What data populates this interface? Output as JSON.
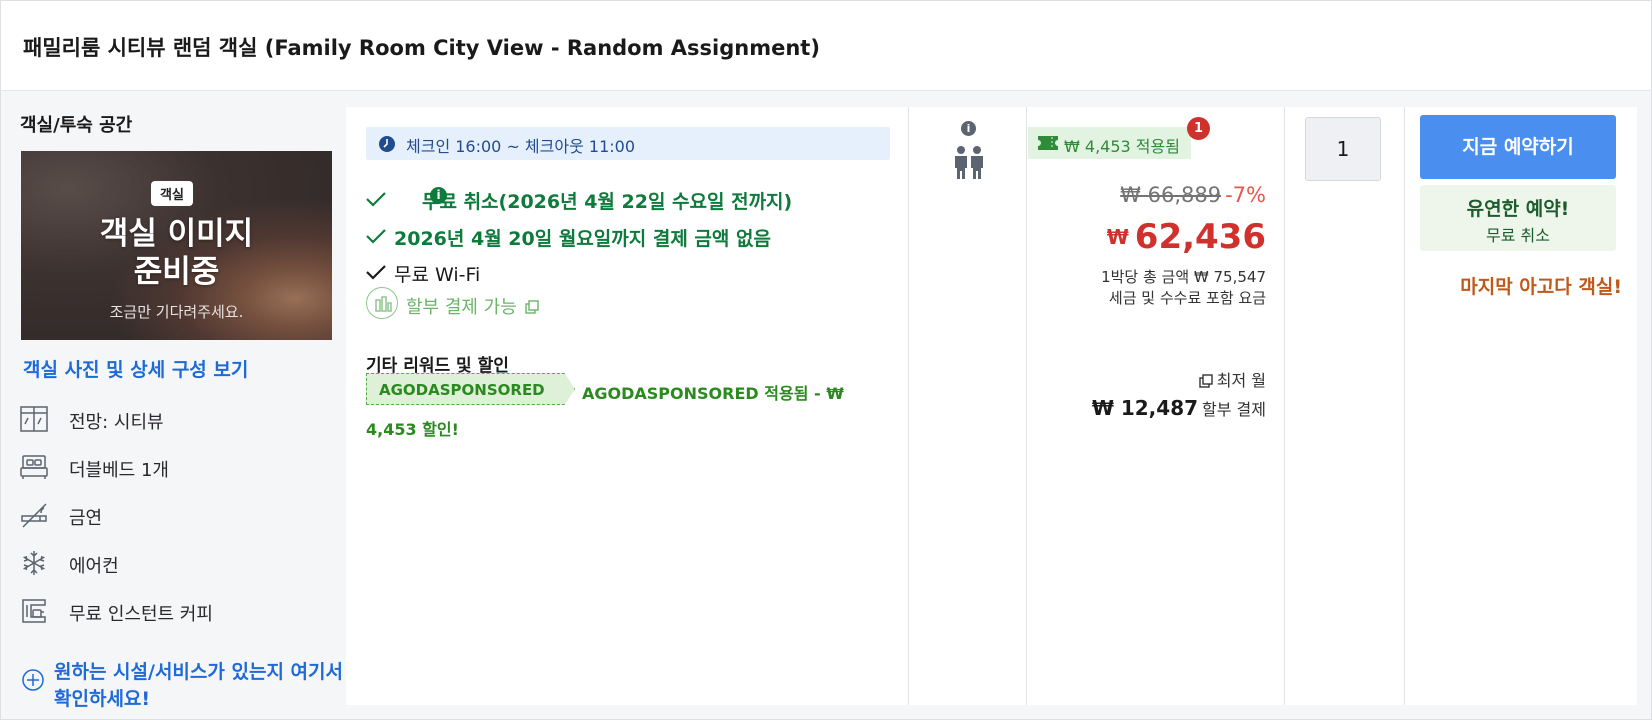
{
  "room": {
    "title": "패밀리룸 시티뷰 랜덤 객실 (Family Room City View - Random Assignment)"
  },
  "left": {
    "section_label": "객실/투숙 공간",
    "image_badge": "객실",
    "image_text_line1": "객실 이미지",
    "image_text_line2": "준비중",
    "image_subtext": "조금만 기다려주세요.",
    "photo_link": "객실 사진 및 상세 구성 보기",
    "amenities": [
      {
        "label": "전망: 시티뷰",
        "icon": "window-view-icon"
      },
      {
        "label": "더블베드 1개",
        "icon": "bed-icon"
      },
      {
        "label": "금연",
        "icon": "no-smoking-icon"
      },
      {
        "label": "에어컨",
        "icon": "snowflake-icon"
      },
      {
        "label": "무료 인스턴트 커피",
        "icon": "coffee-maker-icon"
      }
    ],
    "facility_link": "원하는 시설/서비스가 있는지 여기서 확인하세요!"
  },
  "benefits": {
    "checkin": "체크인 16:00 ~ 체크아웃 11:00",
    "items": [
      "무료 취소(2026년 4월 22일 수요일 전까지)",
      "2026년 4월 20일 월요일까지 결제 금액 없음",
      "무료 Wi-Fi"
    ],
    "installment": "할부 결제 가능",
    "rewards_title": "기타 리워드 및 할인",
    "promo_code": "AGODASPONSORED",
    "promo_desc": "AGODASPONSORED 적용됨 - ₩ 4,453 할인!"
  },
  "occupancy": {
    "info": "i"
  },
  "price": {
    "applied_badge": "₩ 4,453 적용됨",
    "badge_count": "1",
    "original": "₩ 66,889",
    "discount": "-7%",
    "currency": "₩",
    "final": "62,436",
    "note_line1": "1박당 총 금액 ₩ 75,547",
    "note_line2": "세금 및 수수료 포함 요금",
    "monthly_label": "최저 월",
    "monthly_amount": "₩ 12,487",
    "monthly_suffix": "할부 결제"
  },
  "quantity": {
    "value": "1"
  },
  "booking": {
    "button": "지금 예약하기",
    "flex_title": "유연한 예약!",
    "flex_sub": "무료 취소",
    "last_room": "마지막 아고다 객실!"
  },
  "colors": {
    "accent_blue": "#4a8ff0",
    "link_blue": "#1e6ad6",
    "green": "#0e7a3c",
    "price_red": "#d0312d"
  }
}
